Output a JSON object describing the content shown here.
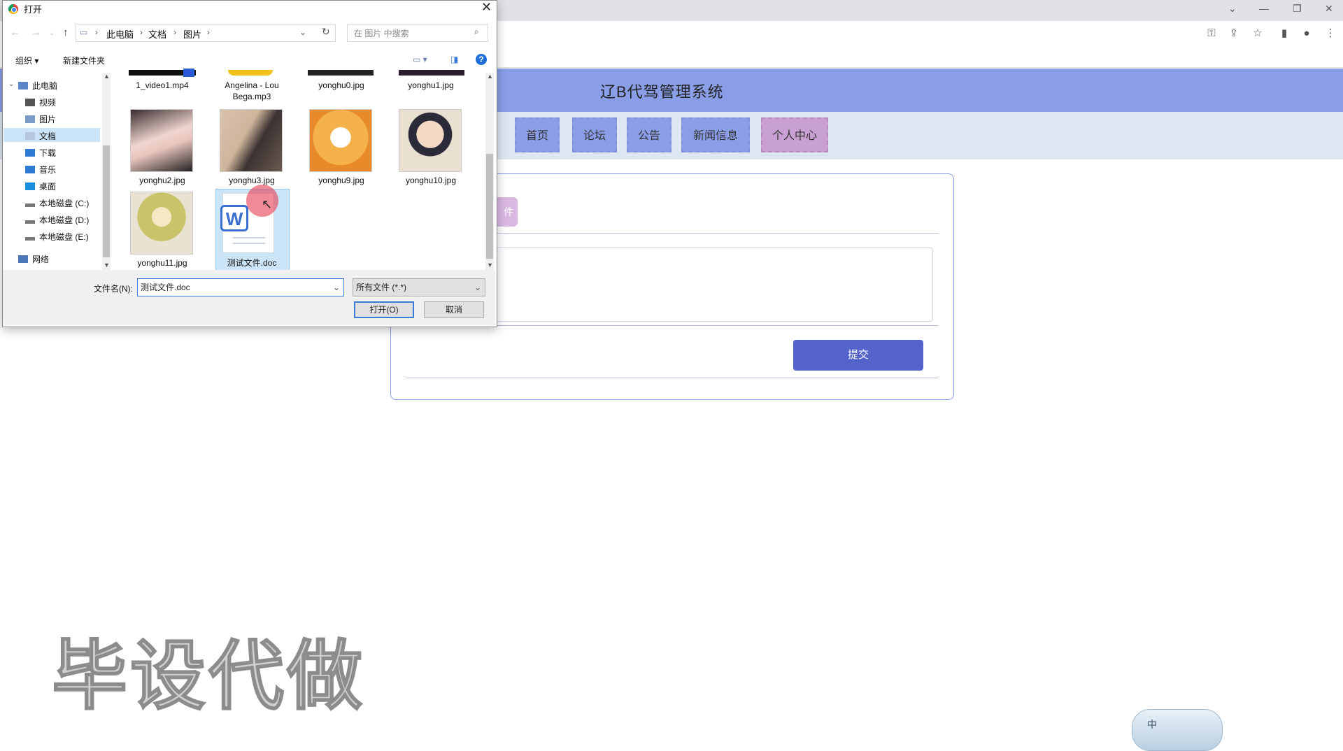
{
  "browser": {
    "window_controls": [
      "⌄",
      "—",
      "❐",
      "✕"
    ],
    "toolbar_icons": [
      "key-icon",
      "share-icon",
      "star-icon",
      "sidebar-icon",
      "profile-icon",
      "menu-icon"
    ]
  },
  "site": {
    "title": "辽B代驾管理系统",
    "nav": [
      "首页",
      "论坛",
      "公告",
      "新闻信息",
      "个人中心"
    ],
    "active_nav": "个人中心",
    "upload_label": "件",
    "submit_label": "提交"
  },
  "watermark": "毕设代做",
  "ime": {
    "label": "中"
  },
  "dialog": {
    "title": "打开",
    "breadcrumbs": [
      "此电脑",
      "文档",
      "图片"
    ],
    "search_placeholder": "在 图片 中搜索",
    "toolbar": {
      "organize": "组织 ▾",
      "new_folder": "新建文件夹"
    },
    "tree": [
      {
        "label": "此电脑",
        "icon": "computer-icon"
      },
      {
        "label": "视频",
        "icon": "video-icon"
      },
      {
        "label": "图片",
        "icon": "picture-icon"
      },
      {
        "label": "文档",
        "icon": "document-icon"
      },
      {
        "label": "下载",
        "icon": "download-icon"
      },
      {
        "label": "音乐",
        "icon": "music-icon"
      },
      {
        "label": "桌面",
        "icon": "desktop-icon"
      },
      {
        "label": "本地磁盘 (C:)",
        "icon": "drive-icon"
      },
      {
        "label": "本地磁盘 (D:)",
        "icon": "drive-icon"
      },
      {
        "label": "本地磁盘 (E:)",
        "icon": "drive-icon"
      },
      {
        "label": "网络",
        "icon": "network-icon"
      }
    ],
    "selected_tree": "文档",
    "files_top_row": [
      "1_video1.mp4",
      "Angelina - Lou Bega.mp3",
      "yonghu0.jpg",
      "yonghu1.jpg"
    ],
    "files": [
      {
        "name": "yonghu2.jpg"
      },
      {
        "name": "yonghu3.jpg"
      },
      {
        "name": "yonghu9.jpg"
      },
      {
        "name": "yonghu10.jpg"
      },
      {
        "name": "yonghu11.jpg"
      },
      {
        "name": "测试文件.doc"
      }
    ],
    "selected_file": "测试文件.doc",
    "filename_label": "文件名(N):",
    "filename_value": "测试文件.doc",
    "filetype_value": "所有文件 (*.*)",
    "open_label": "打开(O)",
    "cancel_label": "取消",
    "colors": {
      "selection": "#cce4f7",
      "accent": "#3a7bd5"
    }
  }
}
